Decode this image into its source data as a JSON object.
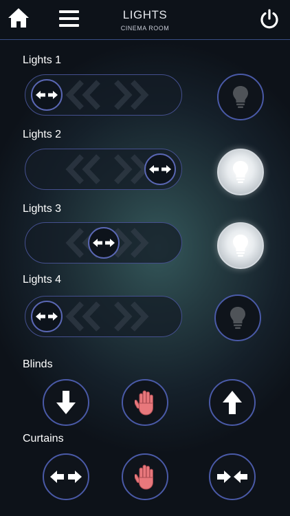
{
  "header": {
    "title": "LIGHTS",
    "subtitle": "CINEMA ROOM",
    "home_icon": "home-icon",
    "menu_icon": "hamburger-menu-icon",
    "power_icon": "power-icon"
  },
  "lights": [
    {
      "label": "Lights 1",
      "dimmer_level": 0,
      "state": "off"
    },
    {
      "label": "Lights 2",
      "dimmer_level": 1,
      "state": "on"
    },
    {
      "label": "Lights 3",
      "dimmer_level": 0.5,
      "state": "on"
    },
    {
      "label": "Lights 4",
      "dimmer_level": 0,
      "state": "off"
    }
  ],
  "blinds": {
    "label": "Blinds",
    "buttons": [
      "arrow-down-icon",
      "stop-hand-icon",
      "arrow-up-icon"
    ]
  },
  "curtains": {
    "label": "Curtains",
    "buttons": [
      "arrows-outward-icon",
      "stop-hand-icon",
      "arrows-inward-icon"
    ]
  },
  "colors": {
    "accent_border": "#4a5aa8",
    "stop_hand": "#e8787c",
    "bulb_on": "#ffffff",
    "bulb_off": "#4f5358"
  }
}
